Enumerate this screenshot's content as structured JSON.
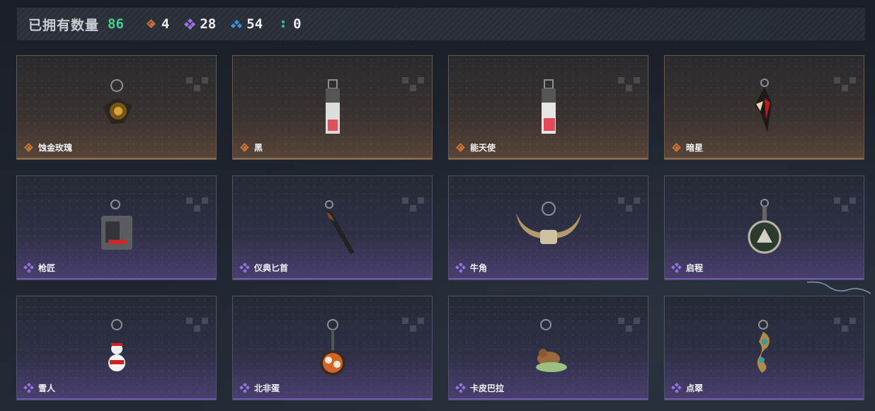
{
  "header": {
    "owned_label": "已拥有数量",
    "owned_count": "86",
    "stats": [
      {
        "icon": "gold-diamond-icon",
        "value": "4"
      },
      {
        "icon": "purple-diamond-icon",
        "value": "28"
      },
      {
        "icon": "blue-diamond-icon",
        "value": "54"
      },
      {
        "icon": "green-dots-icon",
        "value": "0"
      }
    ]
  },
  "colors": {
    "gold": "#c9733a",
    "purple": "#9a73e6",
    "blue": "#3f8fd6",
    "green": "#2bb88a",
    "owned_count": "#3ad48f"
  },
  "items": [
    {
      "name": "蚀金玫瑰",
      "rarity": "gold"
    },
    {
      "name": "黑",
      "rarity": "gold"
    },
    {
      "name": "能天使",
      "rarity": "gold"
    },
    {
      "name": "暗星",
      "rarity": "gold"
    },
    {
      "name": "枪匠",
      "rarity": "purple"
    },
    {
      "name": "仪典匕首",
      "rarity": "purple"
    },
    {
      "name": "牛角",
      "rarity": "purple"
    },
    {
      "name": "启程",
      "rarity": "purple"
    },
    {
      "name": "雪人",
      "rarity": "purple"
    },
    {
      "name": "北非蛋",
      "rarity": "purple"
    },
    {
      "name": "卡皮巴拉",
      "rarity": "purple"
    },
    {
      "name": "点翠",
      "rarity": "purple"
    }
  ]
}
